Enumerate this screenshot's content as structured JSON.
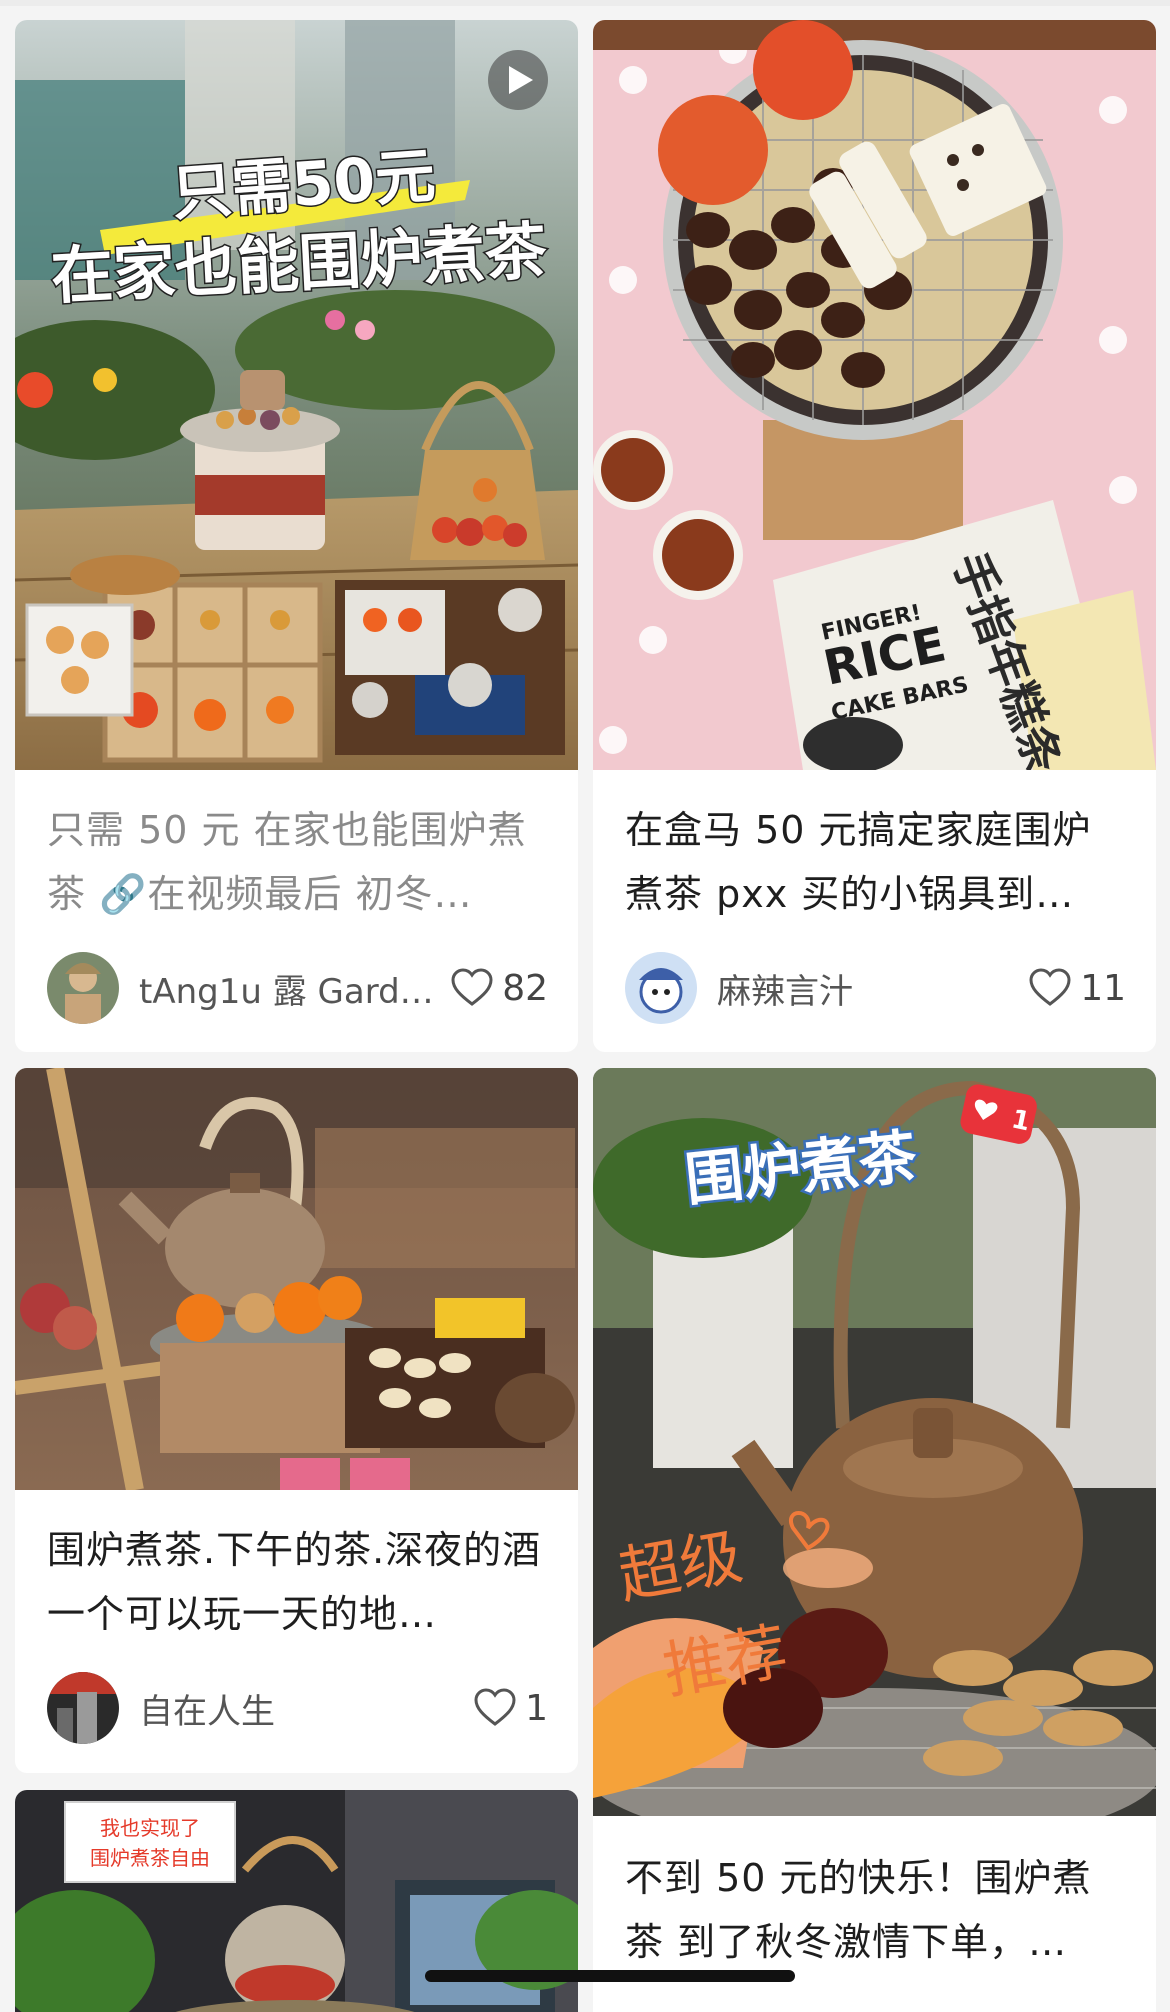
{
  "feed": {
    "cards": [
      {
        "overlay_line1": "只需50元",
        "overlay_line2": "在家也能围炉煮茶",
        "title": "只需 50 元 在家也能围炉煮茶 🔗在视频最后 初冬…",
        "author": "tAng1u 露 Gard…",
        "likes": "82",
        "has_video": true,
        "visited": true
      },
      {
        "package_text1": "FINGER!",
        "package_text2": "RICE",
        "package_text3": "CAKE BARS",
        "package_text4": "手指年糕条",
        "title": "在盒马 50 元搞定家庭围炉煮茶 pxx 买的小锅具到…",
        "author": "麻辣言汁",
        "likes": "11"
      },
      {
        "title": "围炉煮茶.下午的茶.深夜的酒 一个可以玩一天的地…",
        "author": "自在人生",
        "likes": "1"
      },
      {
        "overlay_label": "围炉煮茶",
        "badge_count": "1",
        "handwriting1": "超级",
        "handwriting2": "推荐",
        "title": "不到 50 元的快乐！围炉煮茶 到了秋冬激情下单，…"
      },
      {
        "sticker_line1": "我也实现了",
        "sticker_line2": "围炉煮茶自由"
      }
    ]
  }
}
